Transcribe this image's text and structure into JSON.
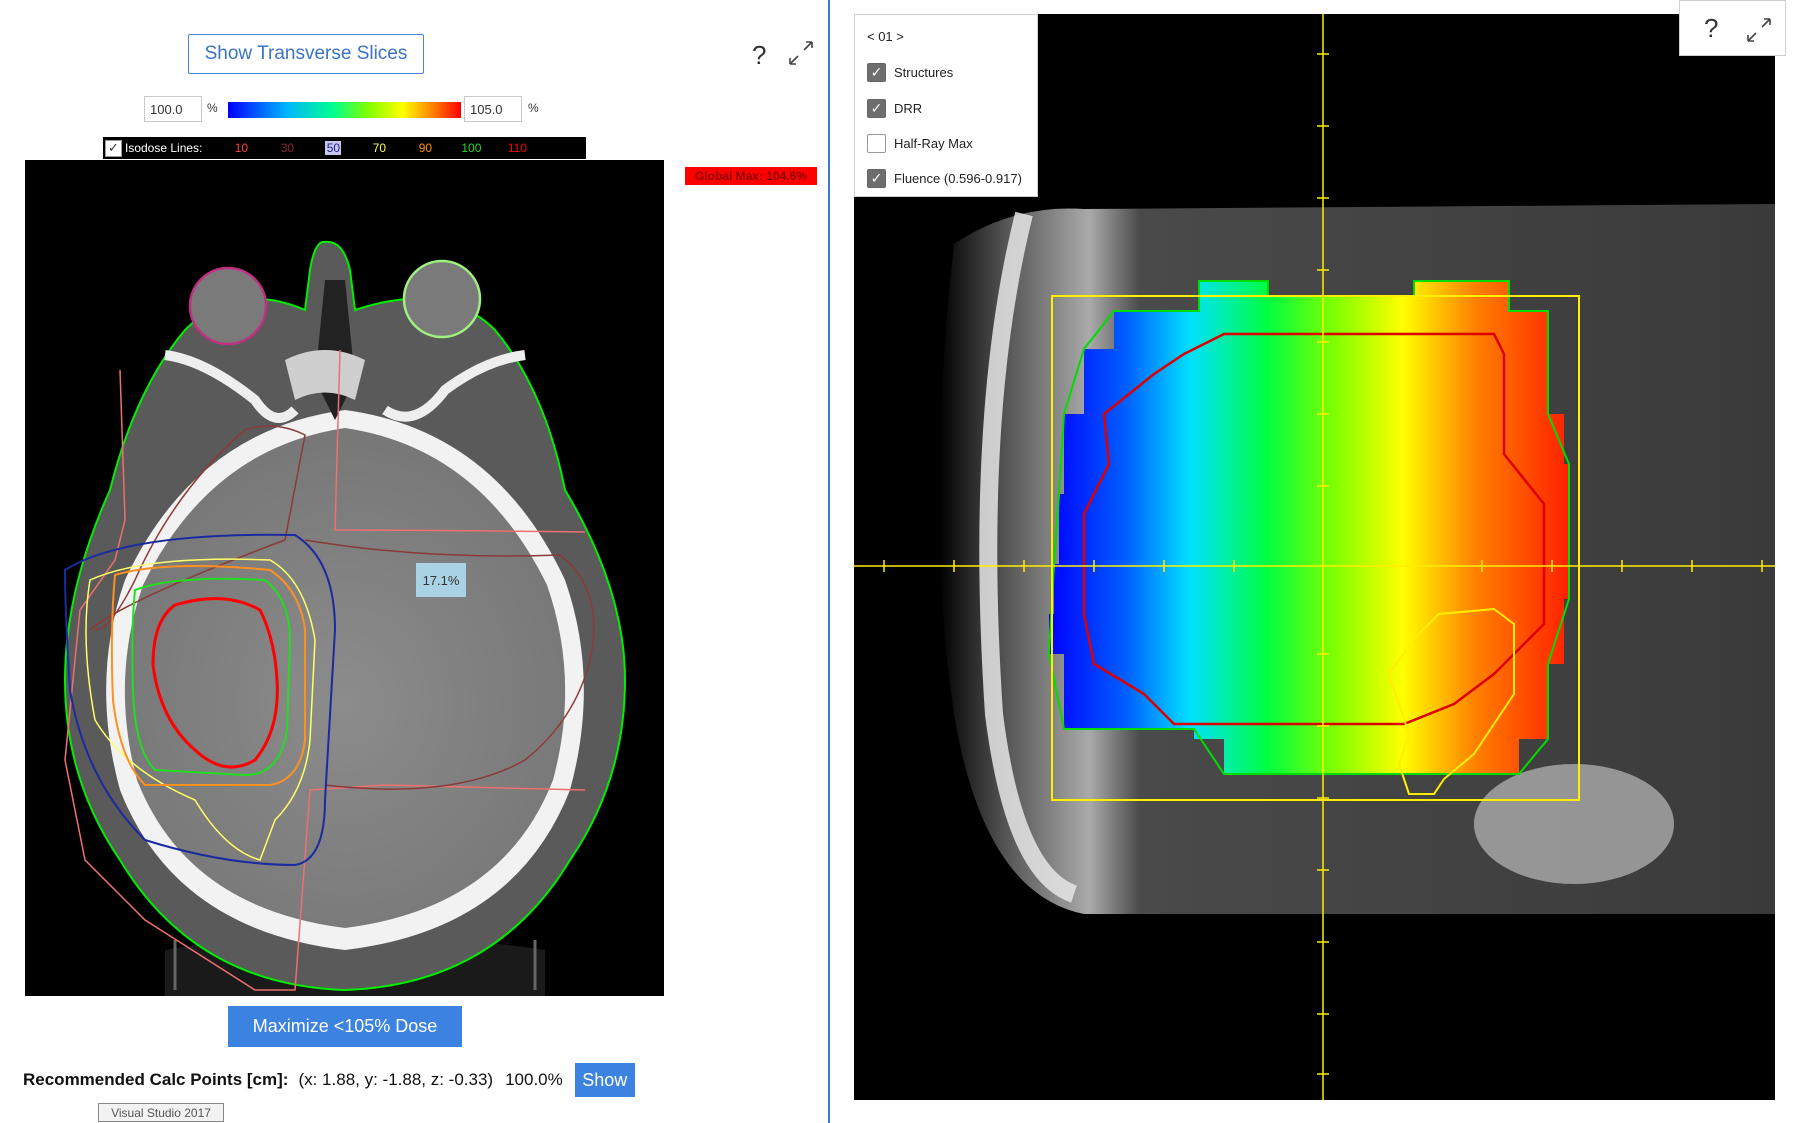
{
  "left": {
    "show_slices_button": "Show Transverse Slices",
    "help_icon": "?",
    "range_min": "100.0",
    "range_max": "105.0",
    "percent_unit": "%",
    "isodose": {
      "label": "Isodose Lines:",
      "checked": true,
      "levels": [
        {
          "value": "10",
          "color": "#ff4040"
        },
        {
          "value": "30",
          "color": "#8b2a2a"
        },
        {
          "value": "50",
          "color": "#1a1aa0"
        },
        {
          "value": "70",
          "color": "#ffff66"
        },
        {
          "value": "90",
          "color": "#ff8c00"
        },
        {
          "value": "100",
          "color": "#22dd22"
        },
        {
          "value": "110",
          "color": "#ff0000"
        }
      ]
    },
    "global_max": "Global Max: 104.6%",
    "tooltip_pct": "17.1%",
    "maximize_button": "Maximize <105% Dose",
    "calc": {
      "title": "Recommended Calc Points [cm]:",
      "coords": "(x: 1.88, y: -1.88, z: -0.33)",
      "percent": "100.0%",
      "show_button": "Show"
    },
    "taskbar_tooltip": "Visual Studio 2017"
  },
  "right": {
    "beam_nav": "< 01 >",
    "layers": [
      {
        "label": "Structures",
        "checked": true
      },
      {
        "label": "DRR",
        "checked": true
      },
      {
        "label": "Half-Ray Max",
        "checked": false
      },
      {
        "label": "Fluence (0.596-0.917)",
        "checked": true
      }
    ],
    "help_icon": "?"
  },
  "colors": {
    "accent": "#3c82e0",
    "divider": "#3f78c8",
    "global_max_bg": "#ff0000"
  }
}
